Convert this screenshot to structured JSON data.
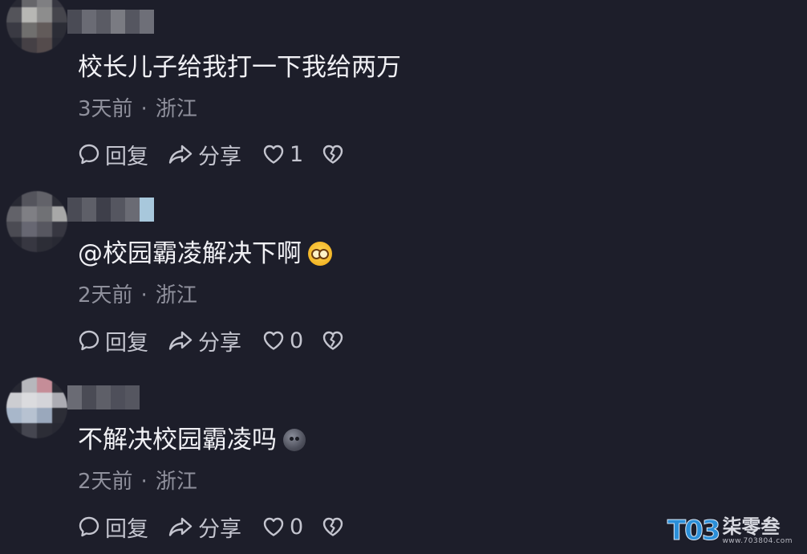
{
  "comments": [
    {
      "text": "校长儿子给我打一下我给两万",
      "emoji": "",
      "time": "3天前",
      "location": "浙江",
      "reply_label": "回复",
      "share_label": "分享",
      "like_count": "1"
    },
    {
      "text": "@校园霸凌解决下啊",
      "emoji": "dizzy-face-emoji",
      "time": "2天前",
      "location": "浙江",
      "reply_label": "回复",
      "share_label": "分享",
      "like_count": "0"
    },
    {
      "text": "不解决校园霸凌吗",
      "emoji": "gray-face-emoji",
      "time": "2天前",
      "location": "浙江",
      "reply_label": "回复",
      "share_label": "分享",
      "like_count": "0"
    }
  ],
  "meta_separator": "·",
  "watermark": {
    "badge": "T03",
    "name": "柒零叁",
    "url": "www.703804.com"
  },
  "colors": {
    "background": "#1d1e2a",
    "text": "#f0f0f4",
    "meta": "#8f909c",
    "action": "#c4c5cf"
  }
}
